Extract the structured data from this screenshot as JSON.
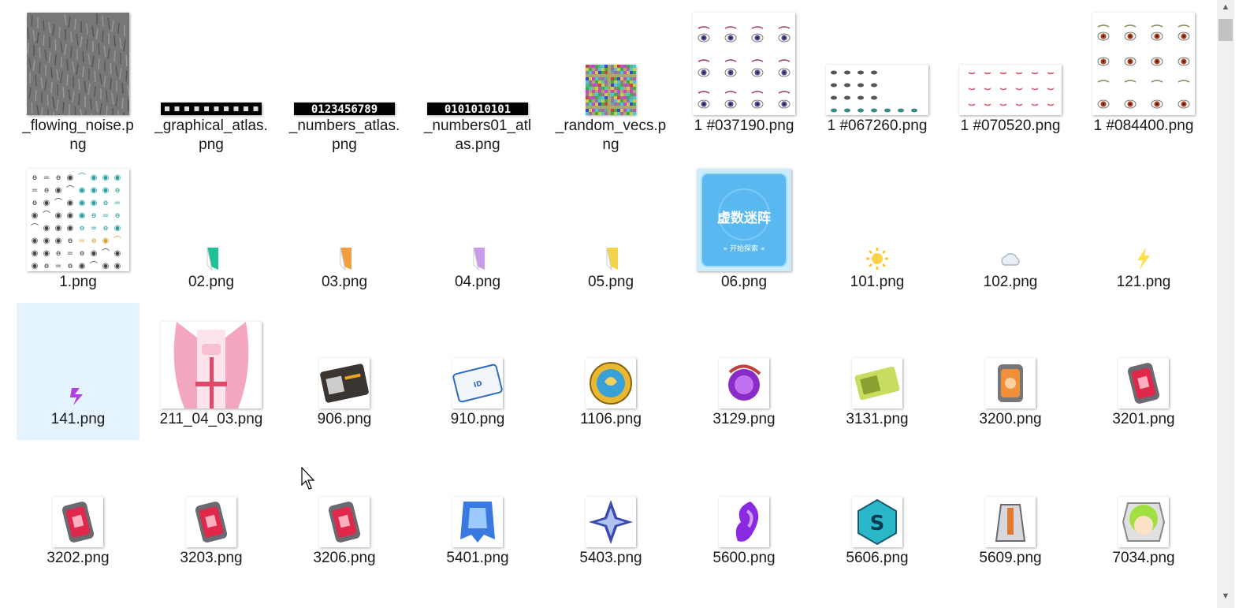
{
  "files": [
    {
      "name": "_flowing_noise.png",
      "thumb": "noise"
    },
    {
      "name": "_graphical_atlas.png",
      "thumb": "strip-icons"
    },
    {
      "name": "_numbers_atlas.png",
      "thumb": "strip-digits"
    },
    {
      "name": "_numbers01_atlas.png",
      "thumb": "strip-binary"
    },
    {
      "name": "_random_vecs.png",
      "thumb": "color-noise"
    },
    {
      "name": "1 #037190.png",
      "thumb": "eyes-purple"
    },
    {
      "name": "1 #067260.png",
      "thumb": "eyes-sheet-small"
    },
    {
      "name": "1 #070520.png",
      "thumb": "mouth-sheet"
    },
    {
      "name": "1 #084400.png",
      "thumb": "eyes-orange"
    },
    {
      "name": "1.png",
      "thumb": "eyes-grid"
    },
    {
      "name": "02.png",
      "thumb": "bookmark-green"
    },
    {
      "name": "03.png",
      "thumb": "bookmark-orange"
    },
    {
      "name": "04.png",
      "thumb": "bookmark-purple"
    },
    {
      "name": "05.png",
      "thumb": "bookmark-yellow"
    },
    {
      "name": "06.png",
      "thumb": "blue-card"
    },
    {
      "name": "101.png",
      "thumb": "sun-icon"
    },
    {
      "name": "102.png",
      "thumb": "cloud-icon"
    },
    {
      "name": "121.png",
      "thumb": "lightning-icon"
    },
    {
      "name": "141.png",
      "thumb": "purple-rune"
    },
    {
      "name": "211_04_03.png",
      "thumb": "pink-character"
    },
    {
      "name": "906.png",
      "thumb": "id-card"
    },
    {
      "name": "910.png",
      "thumb": "device-card"
    },
    {
      "name": "1106.png",
      "thumb": "gold-coin"
    },
    {
      "name": "3129.png",
      "thumb": "purple-orb"
    },
    {
      "name": "3131.png",
      "thumb": "green-ticket"
    },
    {
      "name": "3200.png",
      "thumb": "orange-canister"
    },
    {
      "name": "3201.png",
      "thumb": "red-canister"
    },
    {
      "name": "3202.png",
      "thumb": "red-canister"
    },
    {
      "name": "3203.png",
      "thumb": "red-canister"
    },
    {
      "name": "3206.png",
      "thumb": "red-canister"
    },
    {
      "name": "5401.png",
      "thumb": "blue-cloth"
    },
    {
      "name": "5403.png",
      "thumb": "blue-star-emblem"
    },
    {
      "name": "5600.png",
      "thumb": "purple-ear"
    },
    {
      "name": "5606.png",
      "thumb": "teal-hex-s"
    },
    {
      "name": "5609.png",
      "thumb": "armor-figure"
    },
    {
      "name": "7034.png",
      "thumb": "green-hair-chibi"
    }
  ],
  "selected_file": "141.png",
  "card_text": {
    "title": "虚数迷阵",
    "button": "» 开始探索 «"
  },
  "strip_text": {
    "digits": "0123456789",
    "binary": "0101010101"
  },
  "colors": {
    "selection": "#e5f3ff",
    "scrollbar": "#f0f0f0",
    "scroll_thumb": "#c2c2c2"
  }
}
